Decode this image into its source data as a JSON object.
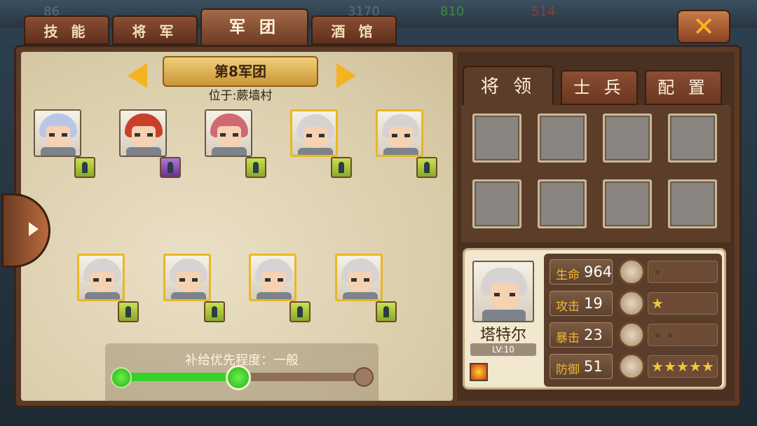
{
  "top_tabs": [
    {
      "label": "技 能"
    },
    {
      "label": "将 军"
    },
    {
      "label": "军 团",
      "active": true
    },
    {
      "label": "酒 馆"
    }
  ],
  "close_label": "✕",
  "background_hud": {
    "a": "86",
    "b": "3170",
    "c": "810",
    "d": "514"
  },
  "legion": {
    "name": "第8军团",
    "location": "位于:蕨墙村"
  },
  "generals": [
    {
      "hair": "#b9c6e6",
      "badge": "green"
    },
    {
      "hair": "#c9402a",
      "badge": "purple"
    },
    {
      "hair": "#d06a72",
      "badge": "green"
    },
    {
      "hair": "#d8d3d3",
      "badge": "green",
      "gold": true
    },
    {
      "hair": "#d8d3d3",
      "badge": "green",
      "gold": true
    },
    {
      "hair": "#d8d3d3",
      "badge": "green",
      "gold": true
    },
    {
      "hair": "#d8d3d3",
      "badge": "green",
      "gold": true
    },
    {
      "hair": "#d8d3d3",
      "badge": "green",
      "gold": true
    },
    {
      "hair": "#d8d3d3",
      "badge": "green",
      "gold": true
    }
  ],
  "supply": {
    "label": "补给优先程度：一般",
    "level_fraction": 0.5
  },
  "right_tabs": [
    {
      "label": "将 领",
      "active": true
    },
    {
      "label": "士 兵"
    },
    {
      "label": "配 置"
    }
  ],
  "hero": {
    "name": "塔特尔",
    "level": "LV:10",
    "stats": [
      {
        "key": "生命",
        "value": "964",
        "equip_icon": "horse-icon",
        "stars": 1,
        "stars_lit": 0
      },
      {
        "key": "攻击",
        "value": "19",
        "equip_icon": "sword-icon",
        "stars": 1,
        "stars_lit": 1
      },
      {
        "key": "暴击",
        "value": "23",
        "equip_icon": "spear-icon",
        "stars": 2,
        "stars_lit": 0
      },
      {
        "key": "防御",
        "value": "51",
        "equip_icon": "bow-icon",
        "stars": 5,
        "stars_lit": 5
      }
    ]
  }
}
